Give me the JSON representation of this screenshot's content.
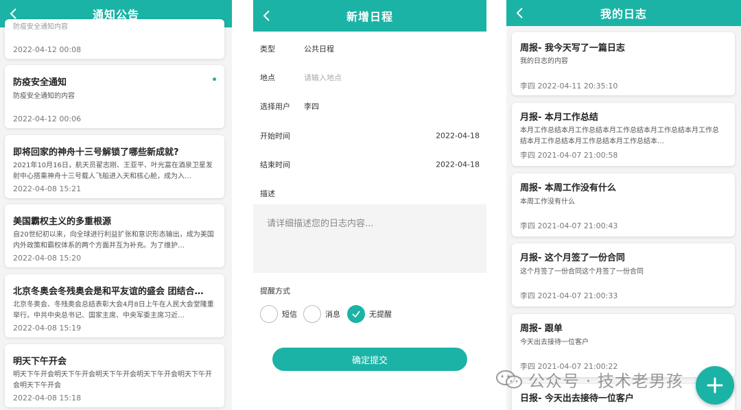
{
  "panel_notices": {
    "title": "通知公告",
    "items": [
      {
        "title": "",
        "body": "防疫安全通知内容",
        "time": "2022-04-12 00:08",
        "unread": false
      },
      {
        "title": "防疫安全通知",
        "body": "防疫安全通知的内容",
        "time": "2022-04-12 00:06",
        "unread": true
      },
      {
        "title": "即将回家的神舟十三号解锁了哪些新成就?",
        "body": "2021年10月16日，航天员翟志刚、王亚平、叶光富在酒泉卫星发射中心搭乘神舟十三号载人飞船进入天和核心舱，成为入…",
        "time": "2022-04-08 15:21",
        "unread": false
      },
      {
        "title": "美国霸权主义的多重根源",
        "body": "自20世纪初以来，向全球进行利益扩张和意识形态输出，成为美国内外政策和霸权体系的两个方面并互为补充。为了维护…",
        "time": "2022-04-08 15:20",
        "unread": false
      },
      {
        "title": "北京冬奥会冬残奥会是和平友谊的盛会 团结合…",
        "body": "北京冬奥会、冬残奥会总结表彰大会4月8日上午在人民大会堂隆重举行。中共中央总书记、国家主席、中央军委主席习近…",
        "time": "2022-04-08 15:19",
        "unread": false
      },
      {
        "title": "明天下午开会",
        "body": "明天下午开会明天下午开会明天下午开会明天下午开会明天下午开会明天下午开会",
        "time": "2022-04-08 15:18",
        "unread": false
      }
    ]
  },
  "panel_schedule": {
    "title": "新增日程",
    "fields": [
      {
        "label": "类型",
        "value": "公共日程",
        "placeholder": false,
        "align": "left"
      },
      {
        "label": "地点",
        "value": "请输入地点",
        "placeholder": true,
        "align": "left"
      },
      {
        "label": "选择用户",
        "value": "李四",
        "placeholder": false,
        "align": "left"
      },
      {
        "label": "开始时间",
        "value": "2022-04-18",
        "placeholder": false,
        "align": "right"
      },
      {
        "label": "结束时间",
        "value": "2022-04-18",
        "placeholder": false,
        "align": "right"
      }
    ],
    "description_label": "描述",
    "description_placeholder": "请详细描述您的日志内容...",
    "remind_label": "提醒方式",
    "remind_options": [
      {
        "label": "短信",
        "checked": false
      },
      {
        "label": "消息",
        "checked": false
      },
      {
        "label": "无提醒",
        "checked": true
      }
    ],
    "submit_label": "确定提交"
  },
  "panel_logs": {
    "title": "我的日志",
    "items": [
      {
        "title": "周报- 我今天写了一篇日志",
        "body": "我的日志的内容",
        "meta": "李四 2022-04-11 20:35:10"
      },
      {
        "title": "月报- 本月工作总结",
        "body": "本月工作总结本月工作总结本月工作总结本月工作总结本月工作总结本月工作总结本月工作总结本月工作总结本…",
        "meta": "李四 2021-04-07 21:00:58"
      },
      {
        "title": "周报- 本周工作没有什么",
        "body": "本周工作没有什么",
        "meta": "李四 2021-04-07 21:00:43"
      },
      {
        "title": "月报- 这个月签了一份合同",
        "body": "这个月签了一份合同这个月签了一份合同",
        "meta": "李四 2021-04-07 21:00:33"
      },
      {
        "title": "周报- 跟单",
        "body": "今天出去接待一位客户",
        "meta": "李四 2021-04-07 21:00:22"
      },
      {
        "title": "日报- 今天出去接待一位客户",
        "body": "",
        "meta": ""
      }
    ]
  },
  "watermark": {
    "text": "公众号 · 技术老男孩"
  },
  "colors": {
    "accent": "#1bb3a5",
    "background": "#f4f4f4"
  },
  "icons": {
    "back": "chevron-left-icon",
    "add": "plus-icon",
    "check": "check-icon",
    "watermark": "wechat-icon"
  }
}
